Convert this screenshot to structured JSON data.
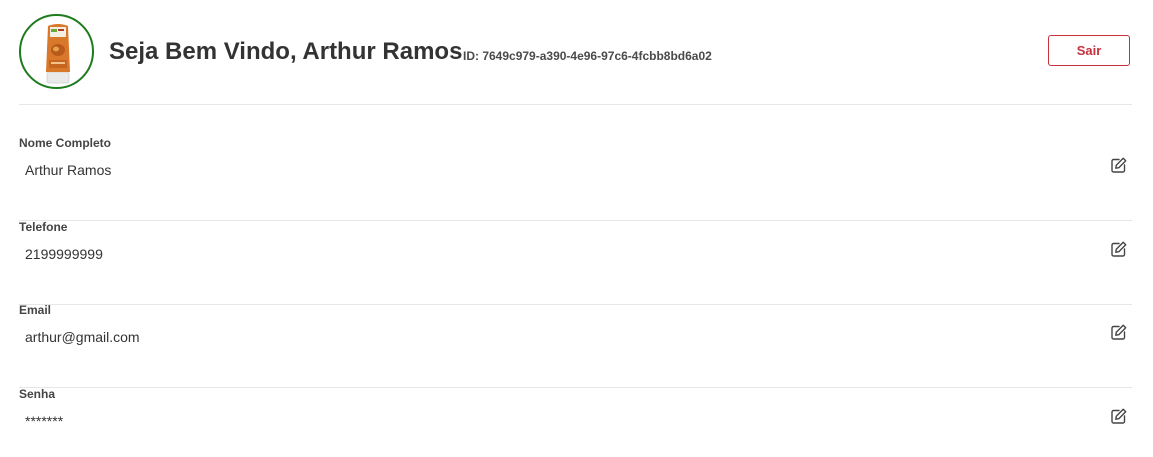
{
  "header": {
    "greeting": "Seja Bem Vindo, Arthur Ramos",
    "user_id": "ID: 7649c979-a390-4e96-97c6-4fcbb8bd6a02",
    "logout_label": "Sair",
    "avatar_icon": "product-bottle-image"
  },
  "fields": [
    {
      "label": "Nome Completo",
      "value": "Arthur Ramos",
      "icon": "edit-icon"
    },
    {
      "label": "Telefone",
      "value": "2199999999",
      "icon": "edit-icon"
    },
    {
      "label": "Email",
      "value": "arthur@gmail.com",
      "icon": "edit-icon"
    },
    {
      "label": "Senha",
      "value": "*******",
      "icon": "edit-icon"
    }
  ],
  "colors": {
    "avatar_border": "#1e7b1e",
    "logout_accent": "#c6313c",
    "divider": "#e6e6e6"
  }
}
